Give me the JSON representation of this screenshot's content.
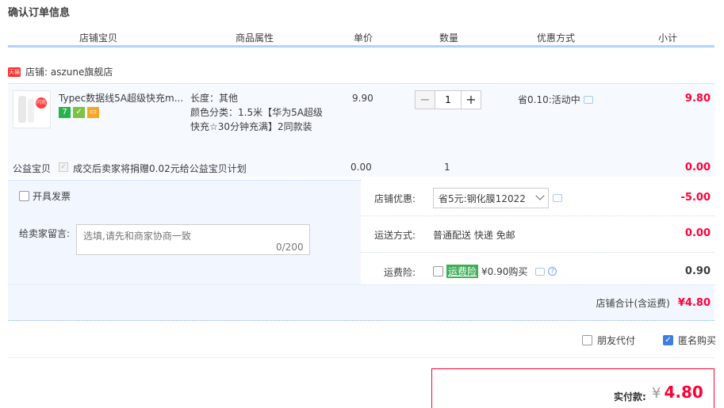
{
  "page_title": "确认订单信息",
  "columns": [
    "店铺宝贝",
    "商品属性",
    "单价",
    "数量",
    "优惠方式",
    "小计"
  ],
  "shop": {
    "badge_text": "天猫",
    "label": "店铺: aszune旗舰店"
  },
  "item": {
    "thumb_text": "闪充",
    "title": "Typec数据线5A超级快充m...",
    "tags": [
      {
        "text": "7",
        "color": "#27b24a"
      },
      {
        "text": "✓",
        "color": "#7dc242"
      },
      {
        "text": "▭",
        "color": "#f5a623"
      }
    ],
    "attr_length": "长度：其他",
    "attr_color": "颜色分类：1.5米【华为5A超级快充☆30分钟充满】2同款装",
    "price": "9.90",
    "quantity": "1",
    "minus": "−",
    "plus": "+",
    "promo": "省0.10:活动中",
    "subtotal": "9.80"
  },
  "charity": {
    "label": "公益宝贝",
    "check": "✓",
    "text": "成交后卖家将捐赠0.02元给公益宝贝计划",
    "price": "0.00",
    "qty": "1",
    "subtotal": "0.00"
  },
  "invoice_label": "开具发票",
  "message": {
    "label": "给卖家留言:",
    "placeholder": "选填,请先和商家协商一致",
    "count": "0/200"
  },
  "shop_discount": {
    "label": "店铺优惠:",
    "selected": "省5元:钢化膜12022",
    "value": "-5.00"
  },
  "shipping": {
    "label": "运送方式:",
    "value_text": "普通配送 快递 免邮",
    "value": "0.00"
  },
  "insurance": {
    "label": "运费险:",
    "tag": "运费险",
    "price_text": "¥0.90购买",
    "help": "?",
    "value": "0.90"
  },
  "shop_total": {
    "label": "店铺合计(含运费)",
    "value": "¥4.80"
  },
  "friend_pay_label": "朋友代付",
  "anon_buy": {
    "label": "匿名购买",
    "check": "✓"
  },
  "payment": {
    "label": "实付款:",
    "currency": "¥",
    "amount": "4.80"
  }
}
